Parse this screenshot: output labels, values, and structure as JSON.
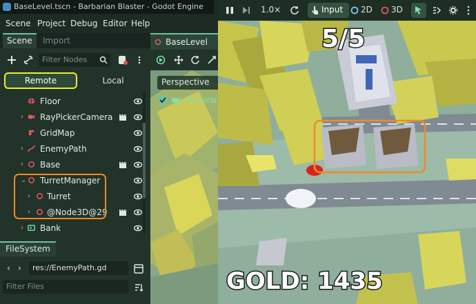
{
  "window": {
    "title": "BaseLevel.tscn - Barbarian Blaster - Godot Engine"
  },
  "menu": [
    "Scene",
    "Project",
    "Debug",
    "Editor",
    "Help"
  ],
  "dock_tabs": {
    "scene": "Scene",
    "import": "Import"
  },
  "scene_filter": {
    "placeholder": "Filter Nodes"
  },
  "mode": {
    "remote": "Remote",
    "local": "Local"
  },
  "tree": [
    {
      "label": "Floor",
      "icon": "mesh-icon",
      "expandable": false
    },
    {
      "label": "RayPickerCamera",
      "icon": "camera-icon",
      "expandable": true,
      "clapper": true
    },
    {
      "label": "GridMap",
      "icon": "gridmap-icon",
      "expandable": false
    },
    {
      "label": "EnemyPath",
      "icon": "path-icon",
      "expandable": true
    },
    {
      "label": "Base",
      "icon": "node3d-icon",
      "expandable": true,
      "clapper": true
    },
    {
      "label": "TurretManager",
      "icon": "node3d-icon",
      "expandable": true,
      "expanded": true
    },
    {
      "label": "Turret",
      "icon": "node3d-icon",
      "expandable": true
    },
    {
      "label": "@Node3D@29",
      "icon": "node3d-icon",
      "expandable": true,
      "clapper": true
    },
    {
      "label": "Bank",
      "icon": "label-icon",
      "expandable": true
    }
  ],
  "filesystem": {
    "tab": "FileSystem",
    "path": "res://EnemyPath.gd",
    "filter_placeholder": "Filter Files"
  },
  "editor_tab": {
    "label": "BaseLevel"
  },
  "viewport_left": {
    "perspective": "Perspective",
    "preview": "Preview"
  },
  "toolbar": {
    "zoom": "1.0×",
    "input": "Input",
    "mode2d": "2D",
    "mode3d": "3D"
  },
  "game": {
    "wave": "5/5",
    "gold": "GOLD: 1435"
  },
  "colors": {
    "highlight_yellow": "#f3ee26",
    "highlight_orange": "#f08a24",
    "accent_green": "#6fc3a0",
    "node_red": "#e0575b"
  }
}
